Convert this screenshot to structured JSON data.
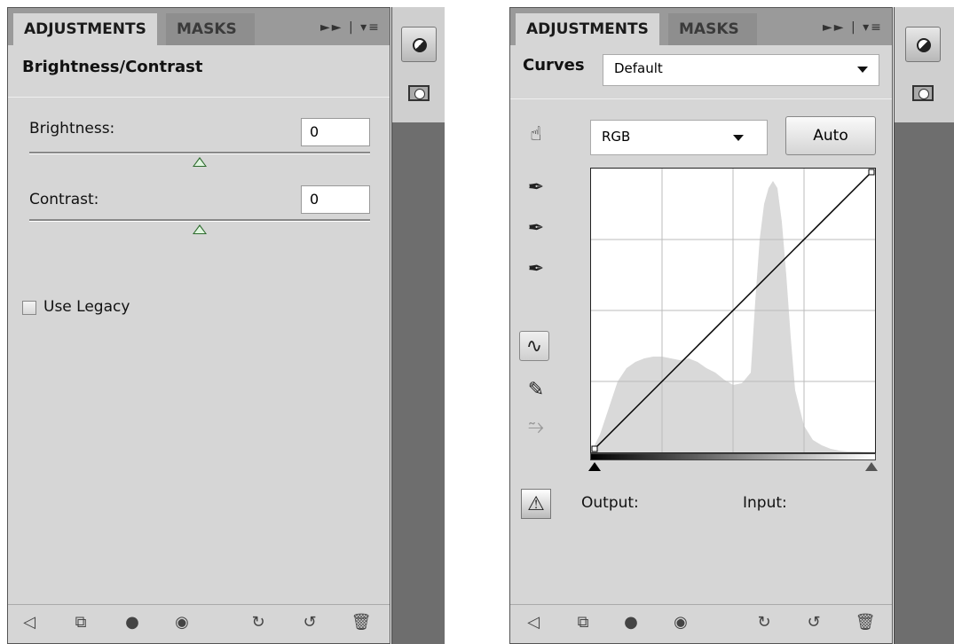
{
  "left_panel": {
    "tabs": [
      "ADJUSTMENTS",
      "MASKS"
    ],
    "title": "Brightness/Contrast",
    "brightness": {
      "label": "Brightness:",
      "value": "0"
    },
    "contrast": {
      "label": "Contrast:",
      "value": "0"
    },
    "use_legacy": {
      "label": "Use Legacy",
      "checked": false
    }
  },
  "right_panel": {
    "tabs": [
      "ADJUSTMENTS",
      "MASKS"
    ],
    "title": "Curves",
    "preset": "Default",
    "channel": "RGB",
    "auto_label": "Auto",
    "output_label": "Output:",
    "input_label": "Input:"
  },
  "icons": {
    "tab_icons": "►► | ▾≡",
    "sidebar": [
      "adjustments-icon",
      "masks-icon"
    ],
    "bottom": [
      "back-arrow-icon",
      "clip-to-layer-icon",
      "layer-visibility-icon",
      "eye-icon",
      "view-previous-icon",
      "reset-icon",
      "trash-icon"
    ]
  },
  "colors": {
    "panel_bg": "#d6d6d6",
    "tab_bar": "#9a9a9a",
    "sidebar": "#6e6e6e"
  }
}
